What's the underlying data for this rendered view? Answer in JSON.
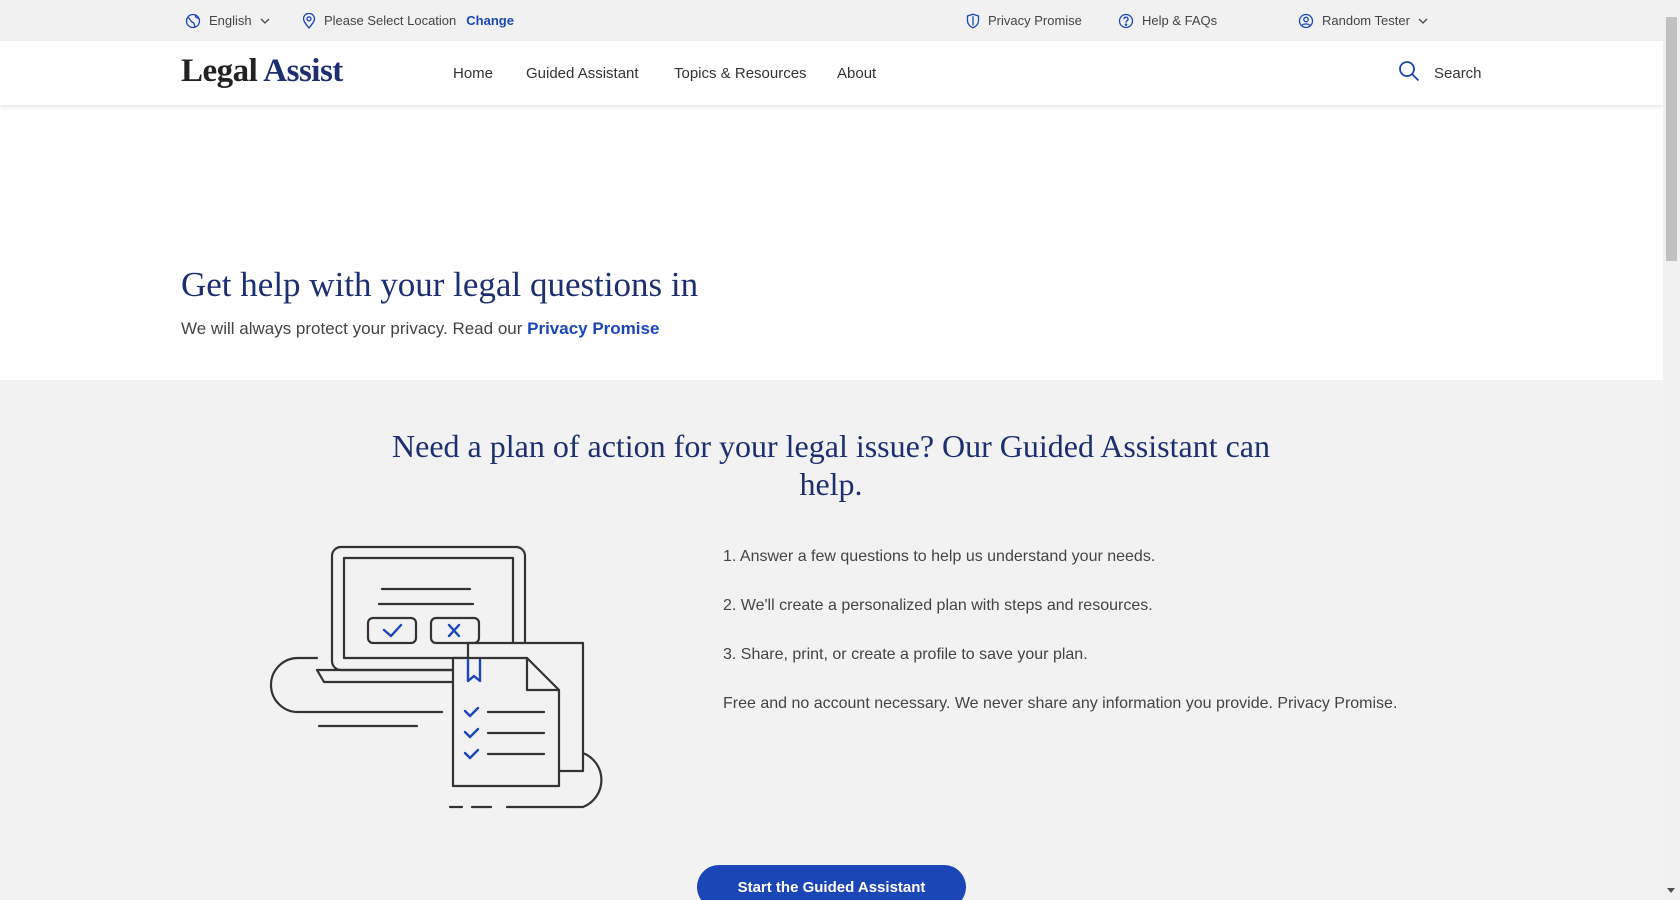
{
  "utility_bar": {
    "language": "English",
    "location_text": "Please Select Location",
    "change_link": "Change",
    "privacy_promise": "Privacy Promise",
    "help": "Help & FAQs",
    "user": "Random Tester"
  },
  "nav": {
    "logo_part1": "Legal",
    "logo_part2": "Assist",
    "links": [
      "Home",
      "Guided Assistant",
      "Topics & Resources",
      "About"
    ],
    "search_label": "Search"
  },
  "hero": {
    "title": "Get help with your legal questions in",
    "subtitle": "We will always protect your privacy. Read our",
    "privacy_link": "Privacy Promise"
  },
  "guided_assistant": {
    "heading": "Need a plan of action for your legal issue? Our Guided Assistant can help.",
    "steps": [
      "1. Answer a few questions to help us understand your needs.",
      "2. We'll create a personalized plan with steps and resources.",
      "3. Share, print, or create a profile to save your plan.",
      "Free and no account necessary. We never share any information you provide. Privacy Promise."
    ],
    "button_label": "Start the Guided Assistant"
  },
  "colors": {
    "brand_blue": "#1a46b7",
    "heading_navy": "#1d2f6f",
    "section_bg": "#f2f2f2",
    "utility_bg": "#f1f1f1"
  },
  "icons": [
    "globe-icon",
    "chevron-down-icon",
    "location-pin-icon",
    "shield-icon",
    "help-circle-icon",
    "user-circle-icon",
    "search-icon",
    "guided-assistant-illustration"
  ]
}
